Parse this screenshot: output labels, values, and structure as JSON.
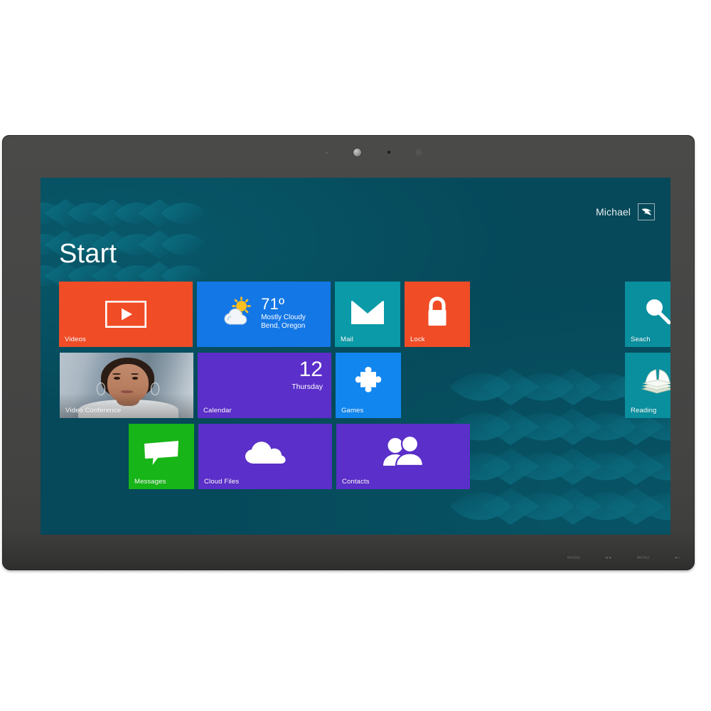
{
  "device": {
    "type": "all-in-one-touchscreen-monitor",
    "webcam_label": "webcam",
    "bezel_buttons": [
      {
        "label": "MODE"
      },
      {
        "label": "◄►"
      },
      {
        "label": "MENU"
      },
      {
        "label": "◄+"
      }
    ]
  },
  "screen": {
    "os_style": "windows-8-start-screen",
    "background_color": "#05495a",
    "header": {
      "page_title": "Start",
      "user_name": "Michael",
      "avatar_icon": "bird-avatar-icon"
    },
    "tiles": [
      {
        "id": "videos",
        "label": "Videos",
        "icon": "play-button-icon",
        "color": "#f04c26",
        "size": "wide"
      },
      {
        "id": "weather",
        "label": "",
        "icon": "sun-behind-cloud-icon",
        "color": "#1477e6",
        "size": "wide",
        "temperature": "71º",
        "condition": "Mostly Cloudy",
        "location": "Bend, Oregon"
      },
      {
        "id": "mail",
        "label": "Mail",
        "icon": "envelope-icon",
        "color": "#0a9aa8",
        "size": "square"
      },
      {
        "id": "lock",
        "label": "Lock",
        "icon": "padlock-icon",
        "color": "#f04c26",
        "size": "square"
      },
      {
        "id": "search",
        "label": "Seach",
        "icon": "magnifying-glass-icon",
        "color": "#0a8f9e",
        "size": "square"
      },
      {
        "id": "video-conference",
        "label": "Video Conference",
        "icon": "person-photo",
        "color": "#8fa0ae",
        "size": "wide"
      },
      {
        "id": "calendar",
        "label": "Calendar",
        "icon": "calendar-date",
        "color": "#5b2fc9",
        "size": "wide",
        "day_number": "12",
        "day_name": "Thursday"
      },
      {
        "id": "games",
        "label": "Games",
        "icon": "puzzle-piece-icon",
        "color": "#1186ef",
        "size": "square"
      },
      {
        "id": "reading",
        "label": "Reading",
        "icon": "open-book-icon",
        "color": "#0a8f9e",
        "size": "square"
      },
      {
        "id": "messages",
        "label": "Messages",
        "icon": "speech-bubble-icon",
        "color": "#17b517",
        "size": "square"
      },
      {
        "id": "cloud-files",
        "label": "Cloud Files",
        "icon": "cloud-icon",
        "color": "#5b2fc9",
        "size": "wide"
      },
      {
        "id": "contacts",
        "label": "Contacts",
        "icon": "two-people-icon",
        "color": "#5b2fc9",
        "size": "wide"
      }
    ]
  }
}
